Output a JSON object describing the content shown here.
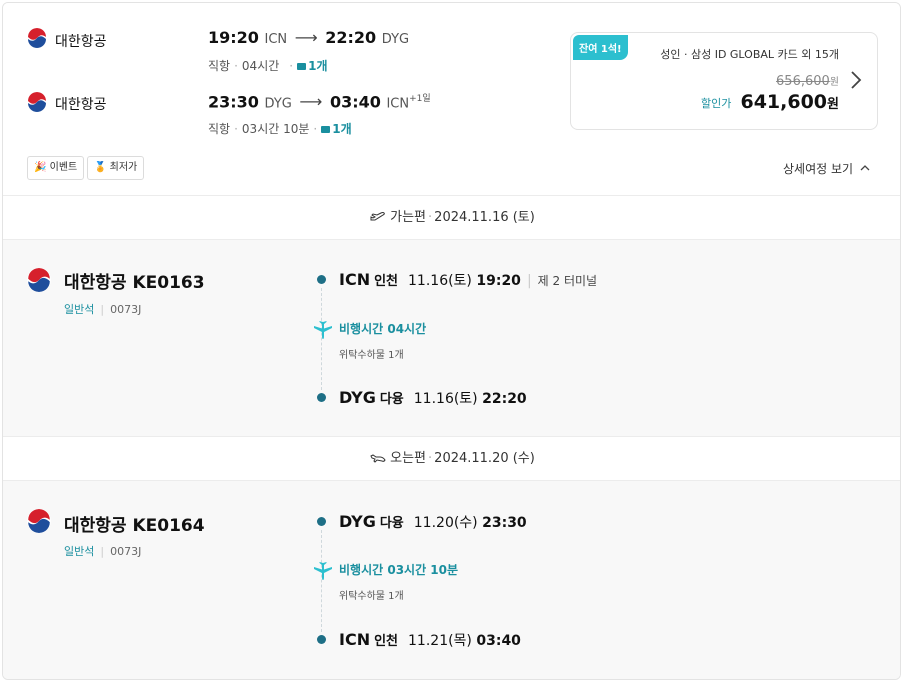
{
  "summary": {
    "outbound": {
      "airline": "대한항공",
      "dep_time": "19:20",
      "dep_code": "ICN",
      "arr_time": "22:20",
      "arr_code": "DYG",
      "arr_day_offset": "",
      "type": "직항",
      "duration": "04시간",
      "baggage": "1개"
    },
    "inbound": {
      "airline": "대한항공",
      "dep_time": "23:30",
      "dep_code": "DYG",
      "arr_time": "03:40",
      "arr_code": "ICN",
      "arr_day_offset": "+1일",
      "type": "직항",
      "duration": "03시간 10분",
      "baggage": "1개"
    },
    "price": {
      "seat_badge": "잔여 1석!",
      "fare_note": "성인 · 삼성 ID GLOBAL 카드 외 15개",
      "original_price": "656,600",
      "original_unit": "원",
      "discount_label": "할인가",
      "discount_price": "641,600",
      "discount_unit": "원"
    },
    "tags": [
      "이벤트",
      "최저가"
    ],
    "detail_toggle": "상세여정 보기"
  },
  "segments": [
    {
      "direction": "가는편",
      "date": "2024.11.16 (토)",
      "flight": "대한항공 KE0163",
      "cabin": "일반석",
      "fare_code": "0073J",
      "departure": {
        "code": "ICN",
        "city": "인천",
        "date": "11.16(토)",
        "time": "19:20",
        "terminal": "제 2 터미널"
      },
      "flight_time": "비행시간 04시간",
      "baggage": "위탁수하물 1개",
      "arrival": {
        "code": "DYG",
        "city": "다융",
        "date": "11.16(토)",
        "time": "22:20"
      }
    },
    {
      "direction": "오는편",
      "date": "2024.11.20 (수)",
      "flight": "대한항공 KE0164",
      "cabin": "일반석",
      "fare_code": "0073J",
      "departure": {
        "code": "DYG",
        "city": "다융",
        "date": "11.20(수)",
        "time": "23:30"
      },
      "flight_time": "비행시간 03시간 10분",
      "baggage": "위탁수하물 1개",
      "arrival": {
        "code": "ICN",
        "city": "인천",
        "date": "11.21(목)",
        "time": "03:40"
      }
    }
  ],
  "colors": {
    "accent": "#1a8f9f",
    "badge": "#2cbfcf",
    "bullet": "#1e6f86",
    "logo_red": "#d6202c",
    "logo_blue": "#1f4e9c"
  },
  "icons": [
    "korean-air-logo-icon",
    "baggage-icon",
    "chevron-right-icon",
    "chevron-up-icon",
    "plane-takeoff-icon",
    "plane-landing-icon",
    "plane-icon",
    "party-icon",
    "medal-icon"
  ]
}
